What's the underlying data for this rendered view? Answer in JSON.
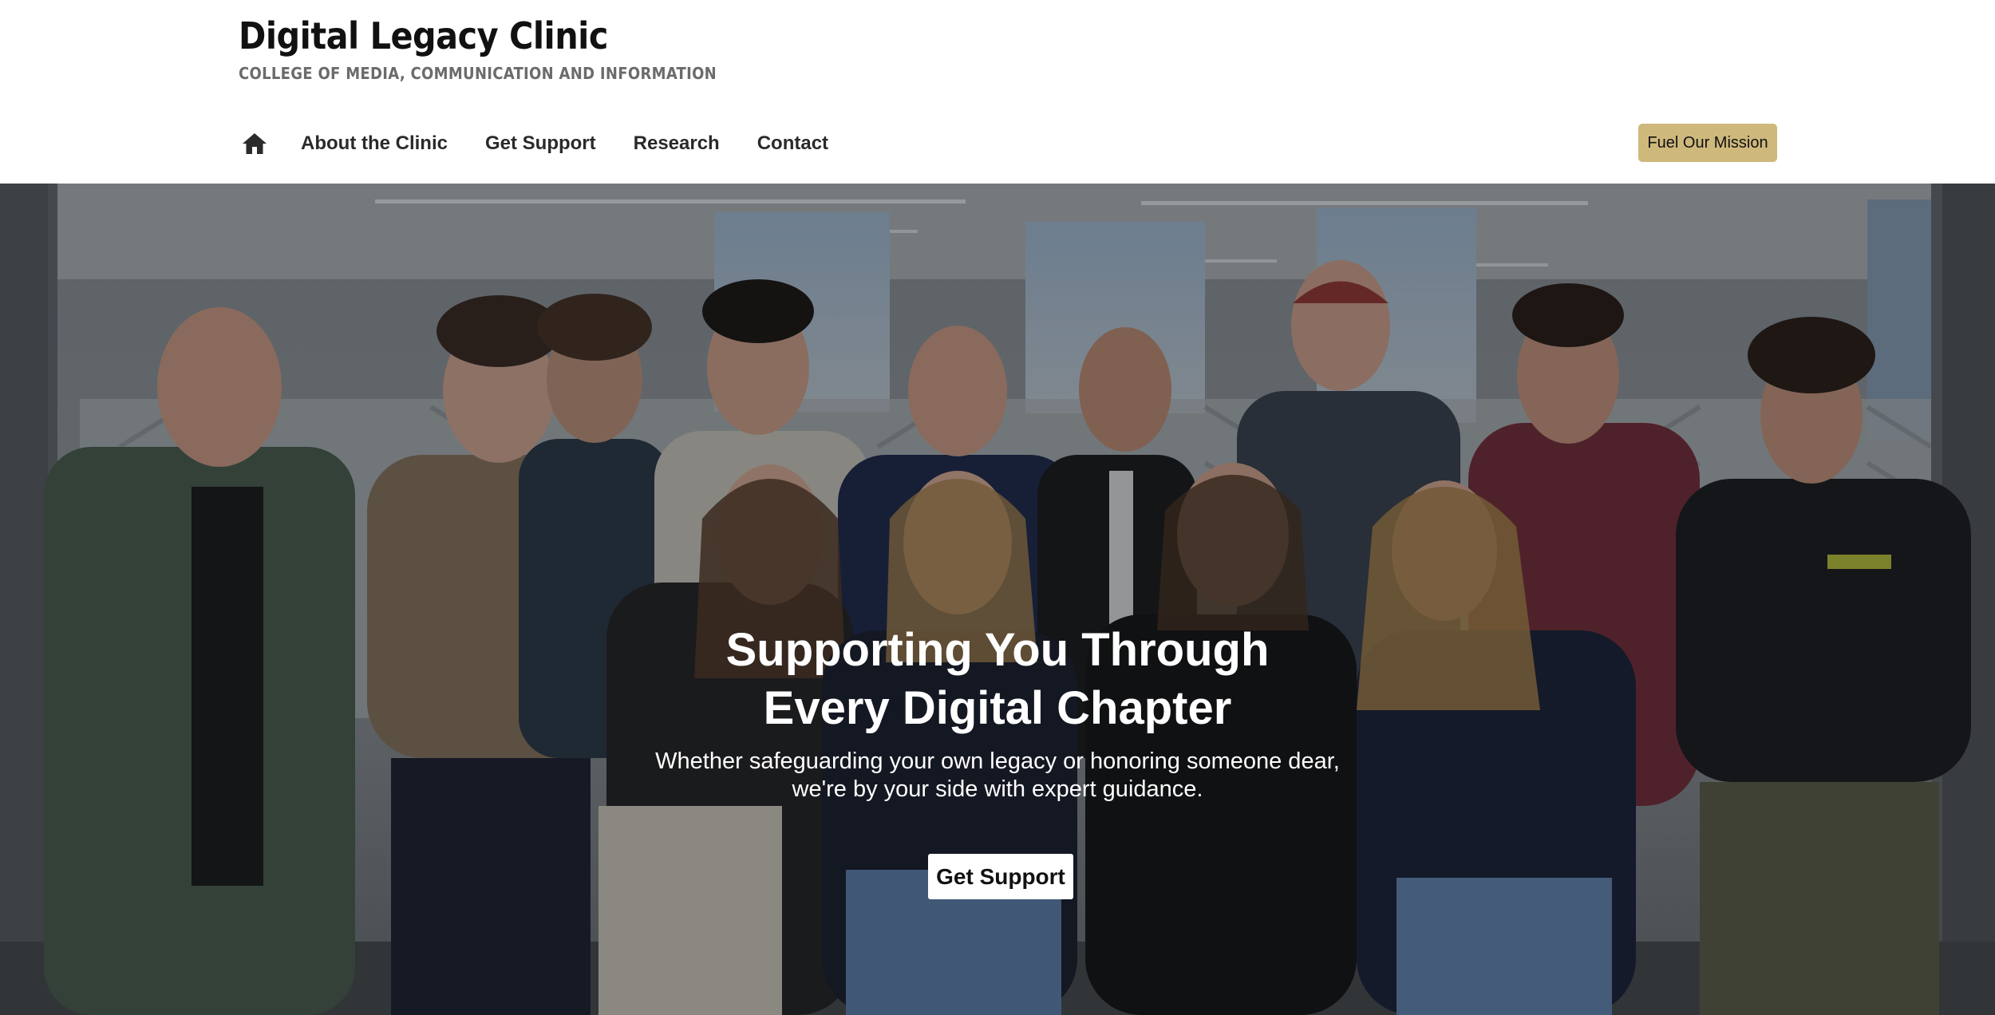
{
  "header": {
    "title": "Digital Legacy Clinic",
    "subtitle": "COLLEGE OF MEDIA, COMMUNICATION AND INFORMATION",
    "home_icon": "home-icon",
    "nav": [
      {
        "label": "About the Clinic"
      },
      {
        "label": "Get Support"
      },
      {
        "label": "Research"
      },
      {
        "label": "Contact"
      }
    ],
    "cta_label": "Fuel Our Mission",
    "cta_color": "#cfb87c"
  },
  "hero": {
    "image": "group-photo",
    "title_line1": "Supporting You Through",
    "title_line2": "Every Digital Chapter",
    "subtitle_line1": "Whether safeguarding your own legacy or honoring someone dear,",
    "subtitle_line2": "we're by your side with expert guidance.",
    "button_label": "Get Support"
  }
}
